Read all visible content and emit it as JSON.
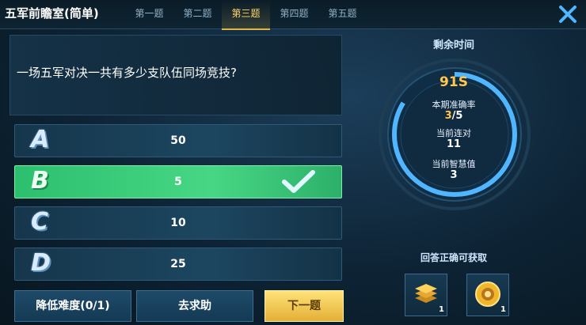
{
  "header": {
    "title": "五军前瞻室(简单)",
    "tabs": [
      "第一题",
      "第二题",
      "第三题",
      "第四题",
      "第五题"
    ]
  },
  "question": {
    "text": "一场五军对决一共有多少支队伍同场竞技?"
  },
  "options": [
    {
      "letter": "A",
      "value": "50"
    },
    {
      "letter": "B",
      "value": "5"
    },
    {
      "letter": "C",
      "value": "10"
    },
    {
      "letter": "D",
      "value": "25"
    }
  ],
  "buttons": {
    "lower": "降低难度(0/1)",
    "help": "去求助",
    "next": "下一题"
  },
  "panel": {
    "remaining_label": "剩余时间",
    "timer": "91S",
    "accuracy_label": "本期准确率",
    "accuracy_correct": "3",
    "accuracy_total": "/5",
    "streak_label": "当前连对",
    "streak": "11",
    "wisdom_label": "当前智慧值",
    "wisdom": "3",
    "reward_label": "回答正确可获取",
    "rewards": [
      {
        "icon": "stack-chips-icon",
        "count": "1"
      },
      {
        "icon": "gold-coin-icon",
        "count": "1"
      }
    ]
  },
  "colors": {
    "correct": "#3ccf78",
    "accent": "#ffc84a"
  }
}
